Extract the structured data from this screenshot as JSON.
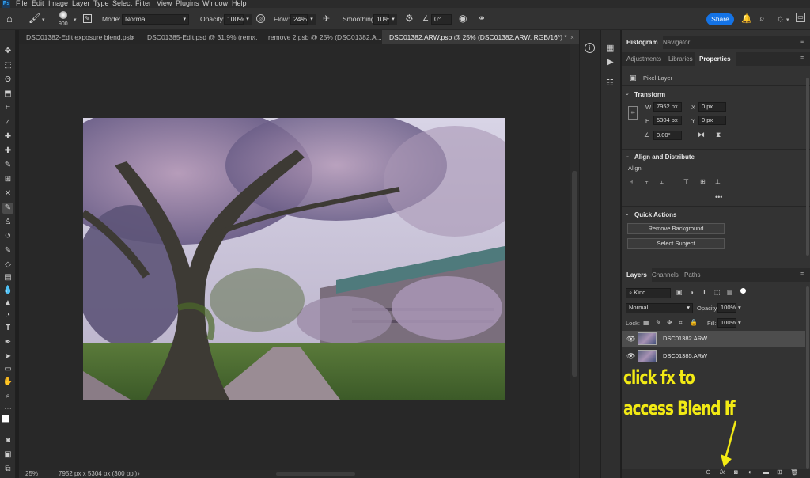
{
  "menu": [
    "File",
    "Edit",
    "Image",
    "Layer",
    "Type",
    "Select",
    "Filter",
    "View",
    "Plugins",
    "Window",
    "Help"
  ],
  "options": {
    "brush_size": "900",
    "mode_label": "Mode:",
    "mode_value": "Normal",
    "opacity_label": "Opacity:",
    "opacity_value": "100%",
    "flow_label": "Flow:",
    "flow_value": "24%",
    "smoothing_label": "Smoothing:",
    "smoothing_value": "10%",
    "angle_value": "0°",
    "share_label": "Share"
  },
  "tabs": [
    {
      "label": "DSC01382-Edit exposure blend.psb"
    },
    {
      "label": "DSC01385-Edit.psd @ 31.9% (rem..."
    },
    {
      "label": "remove 2.psb @ 25% (DSC01382.A..."
    },
    {
      "label": "DSC01382.ARW.psb @ 25% (DSC01382.ARW, RGB/16*) *"
    }
  ],
  "status": {
    "zoom": "25%",
    "doc_size": "7952 px x 5304 px (300 ppi)"
  },
  "panel_top": {
    "tabs": [
      "Histogram",
      "Navigator"
    ],
    "tabs2": [
      "Adjustments",
      "Libraries",
      "Properties"
    ]
  },
  "properties": {
    "kind": "Pixel Layer",
    "transform_title": "Transform",
    "w_label": "W",
    "w_value": "7952 px",
    "h_label": "H",
    "h_value": "5304 px",
    "x_label": "X",
    "x_value": "0 px",
    "y_label": "Y",
    "y_value": "0 px",
    "angle": "0.00°",
    "align_title": "Align and Distribute",
    "align_label": "Align:",
    "quick_title": "Quick Actions",
    "remove_bg": "Remove Background",
    "select_subject": "Select Subject"
  },
  "layers_panel": {
    "tabs": [
      "Layers",
      "Channels",
      "Paths"
    ],
    "filter": "Kind",
    "blend_mode": "Normal",
    "opacity_label": "Opacity:",
    "opacity_value": "100%",
    "lock_label": "Lock:",
    "fill_label": "Fill:",
    "fill_value": "100%",
    "layers": [
      {
        "name": "DSC01382.ARW"
      },
      {
        "name": "DSC01385.ARW"
      }
    ]
  },
  "annotation": {
    "line1": "click fx to",
    "line2": "access Blend If",
    "color": "#f2ea14"
  }
}
